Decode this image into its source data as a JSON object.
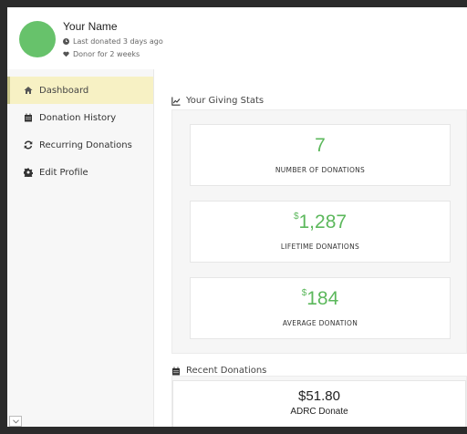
{
  "profile": {
    "name": "Your Name",
    "last_donated": "Last donated 3 days ago",
    "donor_for": "Donor for 2 weeks",
    "avatar_color": "#67c26b"
  },
  "sidebar": {
    "items": [
      {
        "label": "Dashboard",
        "icon": "home-icon",
        "active": true
      },
      {
        "label": "Donation History",
        "icon": "calendar-icon",
        "active": false
      },
      {
        "label": "Recurring Donations",
        "icon": "refresh-icon",
        "active": false
      },
      {
        "label": "Edit Profile",
        "icon": "gear-icon",
        "active": false
      }
    ]
  },
  "stats": {
    "title": "Your Giving Stats",
    "cards": [
      {
        "prefix": "",
        "value": "7",
        "label": "NUMBER OF DONATIONS"
      },
      {
        "prefix": "$",
        "value": "1,287",
        "label": "LIFETIME DONATIONS"
      },
      {
        "prefix": "$",
        "value": "184",
        "label": "AVERAGE DONATION"
      }
    ],
    "accent_color": "#5cb85c"
  },
  "recent": {
    "title": "Recent Donations",
    "items": [
      {
        "amount": "$51.80",
        "name": "ADRC Donate"
      }
    ]
  }
}
